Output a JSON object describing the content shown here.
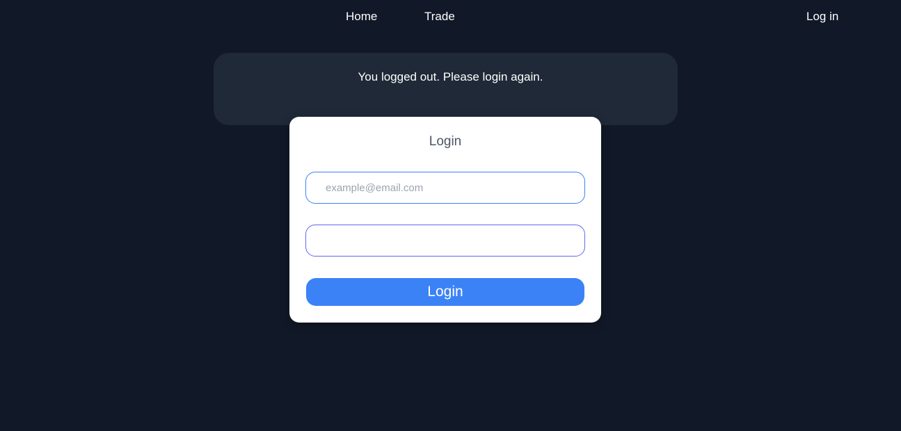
{
  "nav": {
    "home_label": "Home",
    "trade_label": "Trade",
    "login_label": "Log in"
  },
  "notice": {
    "message": "You logged out. Please login again."
  },
  "login_card": {
    "title": "Login",
    "email_placeholder": "example@email.com",
    "email_value": "",
    "password_value": "",
    "submit_label": "Login"
  },
  "colors": {
    "background": "#111827",
    "notice_background": "#1f2937",
    "accent": "#3b82f6",
    "card_background": "#ffffff"
  }
}
